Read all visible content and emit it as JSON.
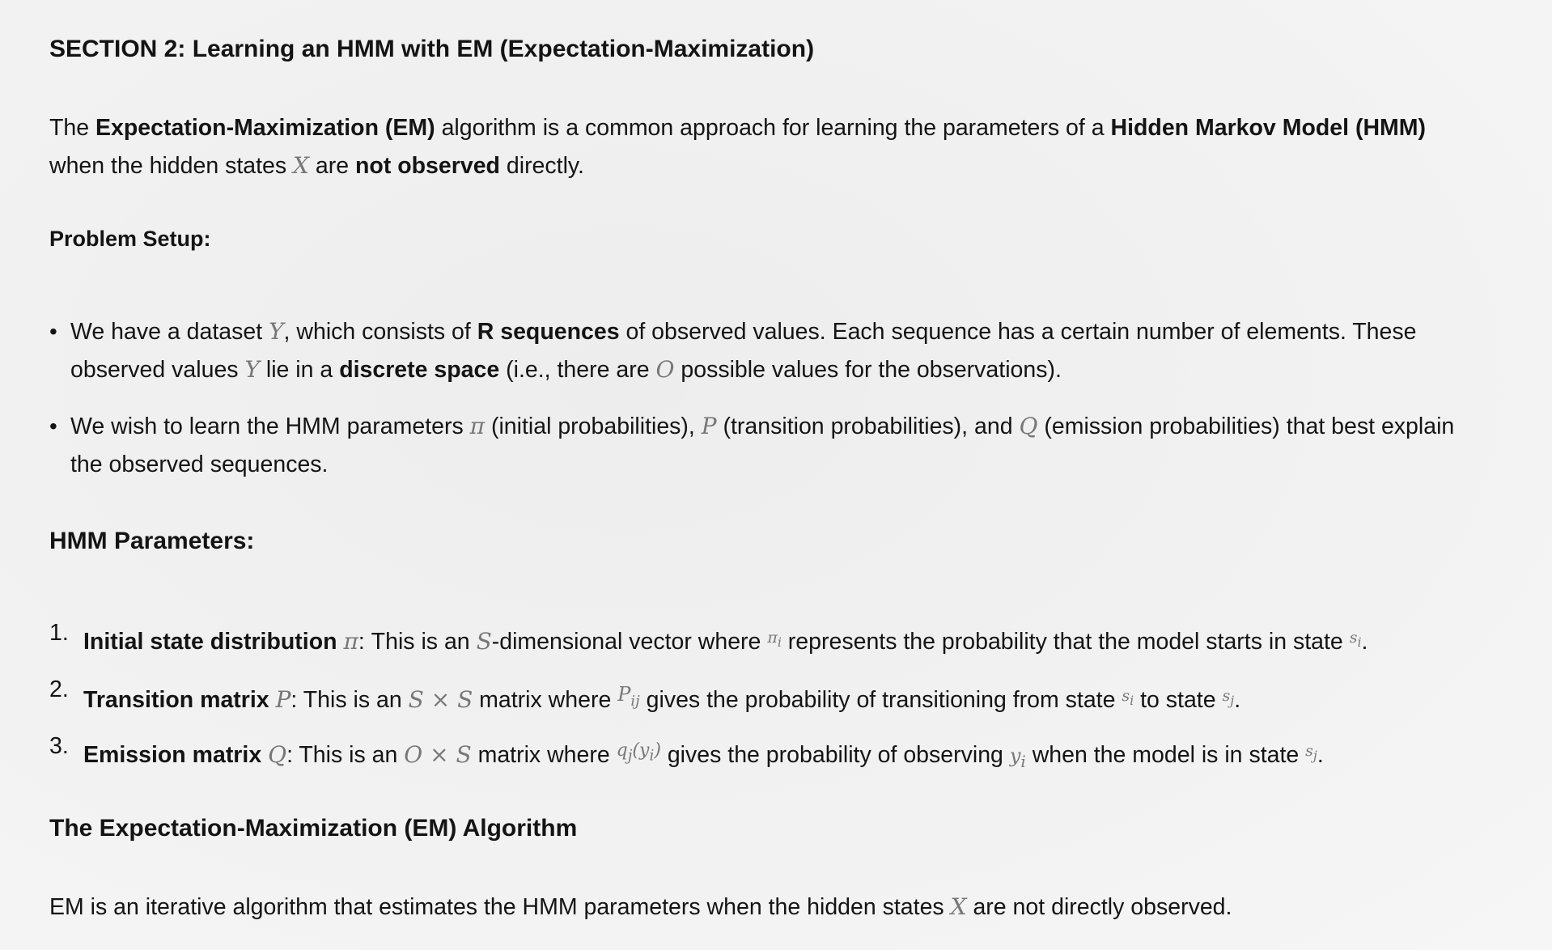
{
  "section_title": "SECTION 2: Learning an HMM with EM (Expectation-Maximization)",
  "intro": {
    "t1": "The ",
    "b1": "Expectation-Maximization (EM)",
    "t2": " algorithm is a common approach for learning the parameters of a ",
    "b2": "Hidden Markov Model (HMM)",
    "t3": "when the hidden states ",
    "m1": "X",
    "t4": " are ",
    "b3": "not observed",
    "t5": " directly."
  },
  "problem_setup": {
    "heading": "Problem Setup:",
    "bullet_char": "•",
    "item1": {
      "t1": "We have a dataset ",
      "m1": "Y",
      "t2": ", which consists of ",
      "b1": "R sequences",
      "t3": " of observed values. Each sequence has a certain number of elements. These",
      "t4": "observed values ",
      "m2": "Y",
      "t5": " lie in a ",
      "b2": "discrete space",
      "t6": " (i.e., there are ",
      "m3": "O",
      "t7": " possible values for the observations)."
    },
    "item2": {
      "t1": "We wish to learn the HMM parameters ",
      "m1": "π",
      "t2": " (initial probabilities), ",
      "m2": "P",
      "t3": " (transition probabilities), and ",
      "m3": "Q",
      "t4": " (emission probabilities) that best explain",
      "t5": "the observed sequences."
    }
  },
  "hmm_parameters": {
    "heading": "HMM Parameters:",
    "items": [
      {
        "num": "1.",
        "bold": "Initial state distribution",
        "sym": "π",
        "t1": ": This is an ",
        "m1": "S",
        "t2": "-dimensional vector where ",
        "m2": "π",
        "m2sub": "i",
        "t3": " represents the probability that the model starts in state ",
        "m3": "s",
        "m3sub": "i",
        "t4": "."
      },
      {
        "num": "2.",
        "bold": "Transition matrix",
        "sym": "P",
        "t1": ": This is an ",
        "m1": "S × S",
        "t2": " matrix where ",
        "m2": "P",
        "m2sub": "ij",
        "t3": " gives the probability of transitioning from state ",
        "m3": "s",
        "m3sub": "i",
        "t4": " to state ",
        "m4": "s",
        "m4sub": "j",
        "t5": "."
      },
      {
        "num": "3.",
        "bold": "Emission matrix",
        "sym": "Q",
        "t1": ": This is an ",
        "m1": "O × S",
        "t2": " matrix where ",
        "m2": "q",
        "m2sub": "j",
        "m2arg": "(y",
        "m2argsub": "i",
        "m2close": ")",
        "t3": " gives the probability of observing ",
        "m3": "y",
        "m3sub": "i",
        "t4": " when the model is in state ",
        "m4": "s",
        "m4sub": "j",
        "t5": "."
      }
    ]
  },
  "em_heading": "The Expectation-Maximization (EM) Algorithm",
  "em_text": {
    "t1": "EM is an iterative algorithm that estimates the HMM parameters when the hidden states ",
    "m1": "X",
    "t2": " are not directly observed."
  }
}
